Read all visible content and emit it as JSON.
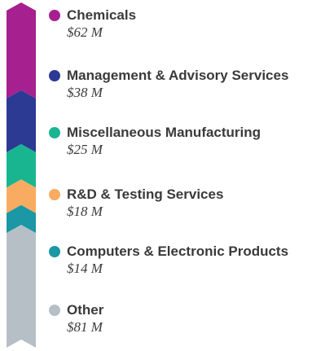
{
  "chart_data": {
    "type": "bar",
    "orientation": "stacked-vertical",
    "unit_prefix": "$",
    "unit_suffix": " M",
    "categories": [
      "Chemicals",
      "Management & Advisory Services",
      "Miscellaneous Manufacturing",
      "R&D & Testing Services",
      "Computers & Electronic Products",
      "Other"
    ],
    "values": [
      62,
      38,
      25,
      18,
      14,
      81
    ],
    "value_labels": [
      "$62 M",
      "$38 M",
      "$25 M",
      "$18 M",
      "$14 M",
      "$81 M"
    ],
    "colors": [
      "#a6218f",
      "#2c3a94",
      "#19b591",
      "#f9ac61",
      "#1b97a6",
      "#b7bfc6"
    ],
    "legend_placement": "right",
    "grid": false
  }
}
